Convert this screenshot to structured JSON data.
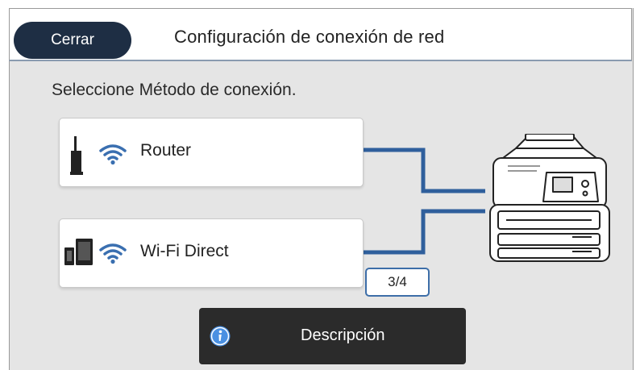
{
  "header": {
    "close_label": "Cerrar",
    "title": "Configuración de conexión de red"
  },
  "instruction": "Seleccione Método de conexión.",
  "options": [
    {
      "label": "Router",
      "icons": [
        "router-icon",
        "wifi-icon"
      ]
    },
    {
      "label": "Wi-Fi Direct",
      "icons": [
        "devices-icon",
        "wifi-icon"
      ]
    }
  ],
  "page_indicator": "3/4",
  "description_button": {
    "label": "Descripción",
    "icon": "info-icon"
  },
  "colors": {
    "header_button_bg": "#1e2e44",
    "accent_blue": "#2f5f9c",
    "panel_bg": "#e5e5e5",
    "description_bg": "#2b2b2b"
  }
}
